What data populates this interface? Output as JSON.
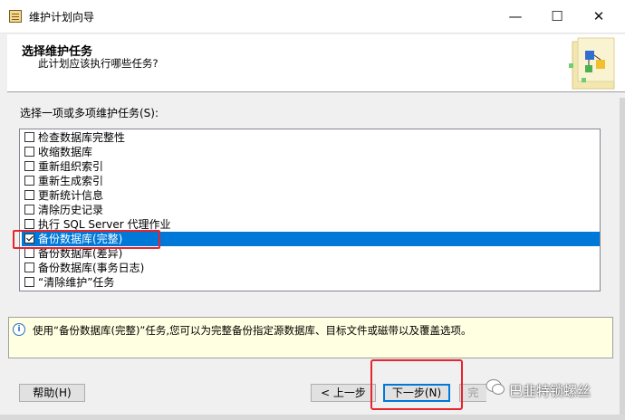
{
  "window": {
    "title": "维护计划向导",
    "minimize": "—",
    "maximize": "☐",
    "close": "✕"
  },
  "header": {
    "title": "选择维护任务",
    "subtitle": "此计划应该执行哪些任务?"
  },
  "task_list": {
    "label": "选择一项或多项维护任务(S):",
    "items": [
      {
        "label": "检查数据库完整性",
        "checked": false,
        "selected": false
      },
      {
        "label": "收缩数据库",
        "checked": false,
        "selected": false
      },
      {
        "label": "重新组织索引",
        "checked": false,
        "selected": false
      },
      {
        "label": "重新生成索引",
        "checked": false,
        "selected": false
      },
      {
        "label": "更新统计信息",
        "checked": false,
        "selected": false
      },
      {
        "label": "清除历史记录",
        "checked": false,
        "selected": false
      },
      {
        "label": "执行 SQL Server 代理作业",
        "checked": false,
        "selected": false
      },
      {
        "label": "备份数据库(完整)",
        "checked": true,
        "selected": true
      },
      {
        "label": "备份数据库(差异)",
        "checked": false,
        "selected": false
      },
      {
        "label": "备份数据库(事务日志)",
        "checked": false,
        "selected": false
      },
      {
        "label": "“清除维护”任务",
        "checked": false,
        "selected": false
      }
    ]
  },
  "info": {
    "icon": "info-icon",
    "text": "使用“备份数据库(完整)”任务,您可以为完整备份指定源数据库、目标文件或磁带以及覆盖选项。"
  },
  "buttons": {
    "help": "帮助(H)",
    "back": "< 上一步",
    "next": "下一步(N)",
    "finish": "完"
  },
  "watermark": "巴韭特锁螺丝",
  "colors": {
    "selection": "#0078d7",
    "highlight_box": "#e8242c",
    "info_background": "#ffffe1"
  }
}
